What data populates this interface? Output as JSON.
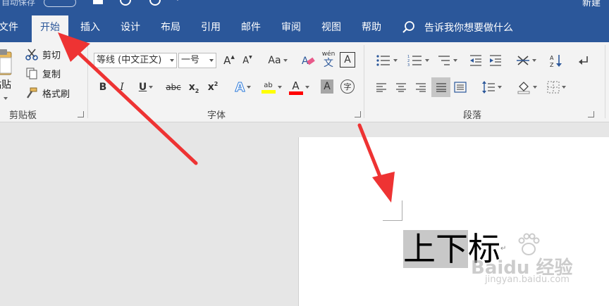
{
  "titlebar": {
    "autosave": "自动保存",
    "doc_title": "新建"
  },
  "tabs": [
    {
      "label": "文件"
    },
    {
      "label": "开始"
    },
    {
      "label": "插入"
    },
    {
      "label": "设计"
    },
    {
      "label": "布局"
    },
    {
      "label": "引用"
    },
    {
      "label": "邮件"
    },
    {
      "label": "审阅"
    },
    {
      "label": "视图"
    },
    {
      "label": "帮助"
    }
  ],
  "tell_me": "告诉我你想要做什么",
  "clipboard": {
    "paste": "粘贴",
    "cut": "剪切",
    "copy": "复制",
    "format_painter": "格式刷",
    "group_label": "剪贴板"
  },
  "font": {
    "font_name": "等线 (中文正文)",
    "font_size": "一号",
    "grow": "A",
    "shrink": "A",
    "change_case": "Aa",
    "pinyin_top": "wén",
    "pinyin_char": "文",
    "border_char": "A",
    "bold": "B",
    "italic": "I",
    "underline": "U",
    "strike": "abc",
    "subscript": "x",
    "subscript_mark": "2",
    "superscript": "x",
    "superscript_mark": "2",
    "effects": "A",
    "highlight": "ab",
    "font_color": "A",
    "shading": "A",
    "enclose": "字",
    "group_label": "字体",
    "highlight_color": "#ffff00",
    "font_color_value": "#ff0000"
  },
  "paragraph": {
    "group_label": "段落"
  },
  "document": {
    "selected_text": "上下",
    "rest_text": "标"
  },
  "watermark": {
    "brand": "Baidu 经验",
    "url": "jingyan.baidu.com"
  },
  "colors": {
    "ribbon_blue": "#2b579a",
    "arrow_red": "#ee3333",
    "selection": "#c8c8c8"
  }
}
